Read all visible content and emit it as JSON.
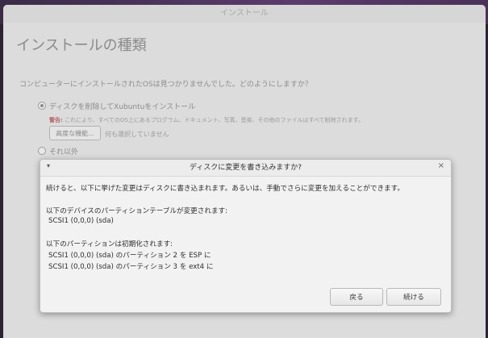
{
  "window": {
    "title": "インストール"
  },
  "page": {
    "heading": "インストールの種類",
    "question": "コンピューターにインストールされたOSは見つかりませんでした。どのようにしますか？",
    "option_erase": {
      "label": "ディスクを削除してXubuntuをインストール",
      "warning_prefix": "警告:",
      "warning_text": " これにより、すべてのOS上にあるプログラム、ドキュメント、写真、音楽、その他のファイルはすべて削除されます。",
      "advanced_button": "高度な機能...",
      "advanced_note": "何も選択していません",
      "selected": true
    },
    "option_other": {
      "label": "それ以外",
      "selected": false
    }
  },
  "dialog": {
    "menu_icon": "▾",
    "title": "ディスクに変更を書き込みますか?",
    "close_icon": "×",
    "intro": "続けると、以下に挙げた変更はディスクに書き込まれます。あるいは、手動でさらに変更を加えることができます。",
    "table_heading": "以下のデバイスのパーティションテーブルが変更されます:",
    "table_device": "SCSI1 (0,0,0) (sda)",
    "format_heading": "以下のパーティションは初期化されます:",
    "format_items": [
      "SCSI1 (0,0,0) (sda) のパーティション 2 を ESP に",
      "SCSI1 (0,0,0) (sda) のパーティション 3 を ext4 に"
    ],
    "back_button": "戻る",
    "continue_button": "続ける"
  }
}
